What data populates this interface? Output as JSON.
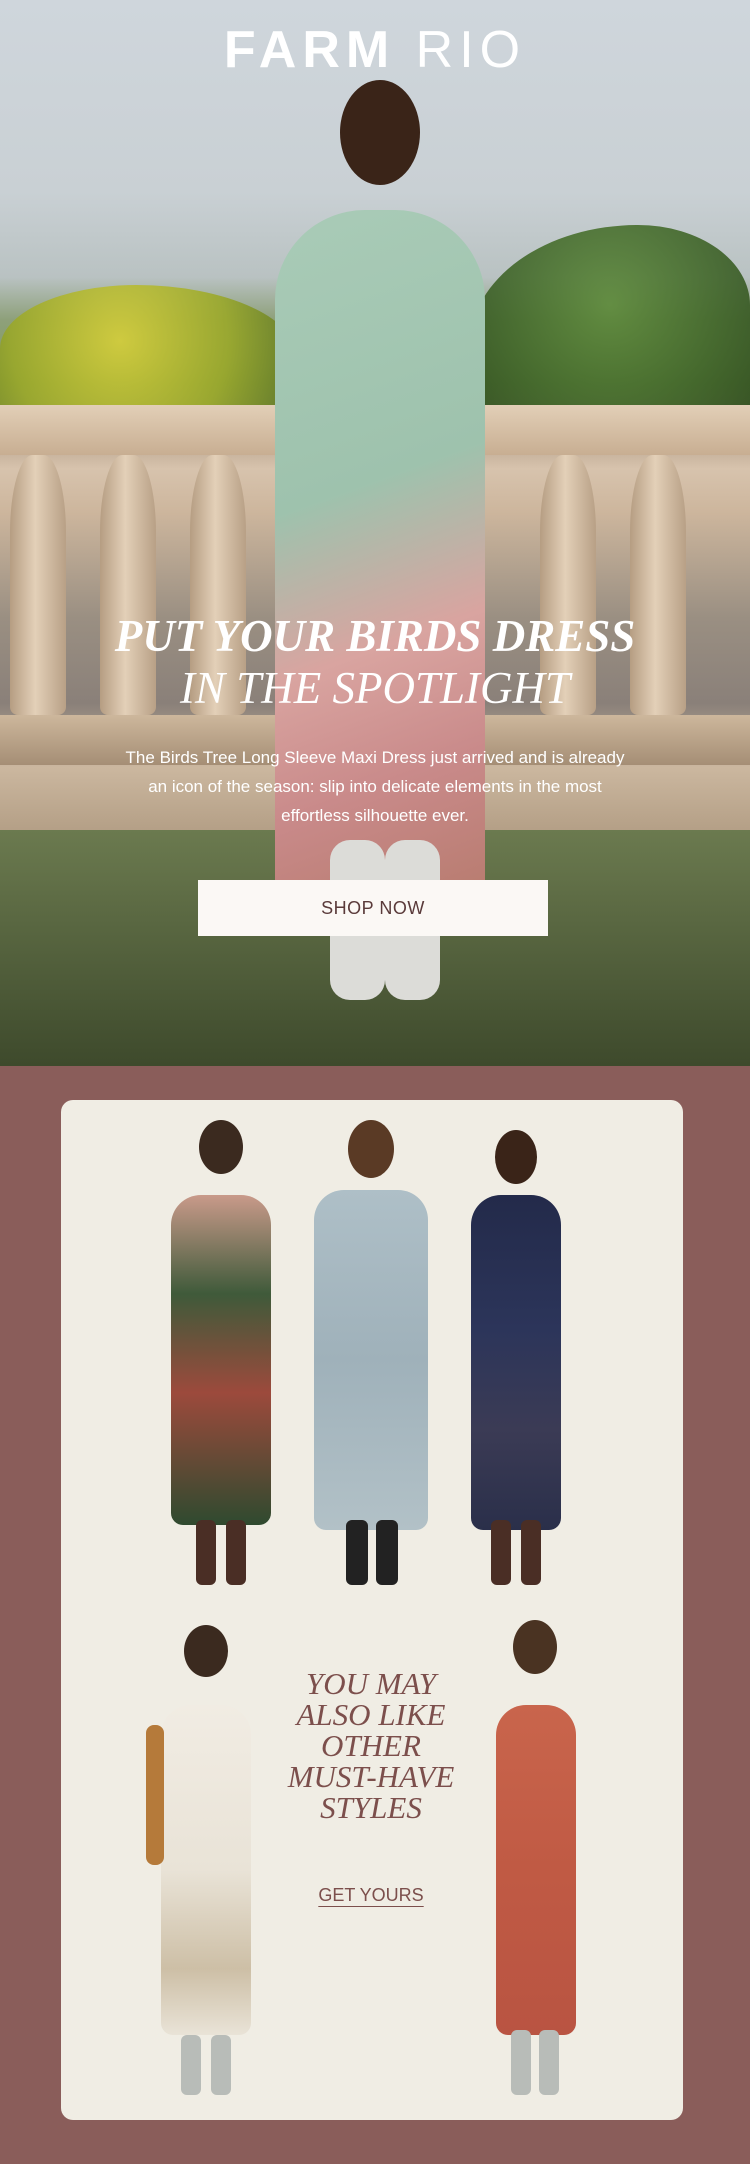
{
  "brand": {
    "logo_bold": "FARM",
    "logo_light": "RIO"
  },
  "hero": {
    "headline_line1": "PUT YOUR BIRDS DRESS",
    "headline_line2": "IN THE SPOTLIGHT",
    "subcopy": "The Birds Tree Long Sleeve Maxi Dress just arrived and is already an icon of the season: slip into delicate elements in the most effortless silhouette ever.",
    "cta_label": "SHOP NOW"
  },
  "promo": {
    "lines": [
      "YOU MAY",
      "ALSO LIKE",
      "OTHER",
      "MUST-HAVE",
      "STYLES"
    ],
    "cta_label": "GET YOURS"
  },
  "colors": {
    "section_bg": "#8a5d5a",
    "card_bg": "#f0ede4",
    "promo_text": "#7c4f4c",
    "button_bg": "#fbf8f5"
  }
}
